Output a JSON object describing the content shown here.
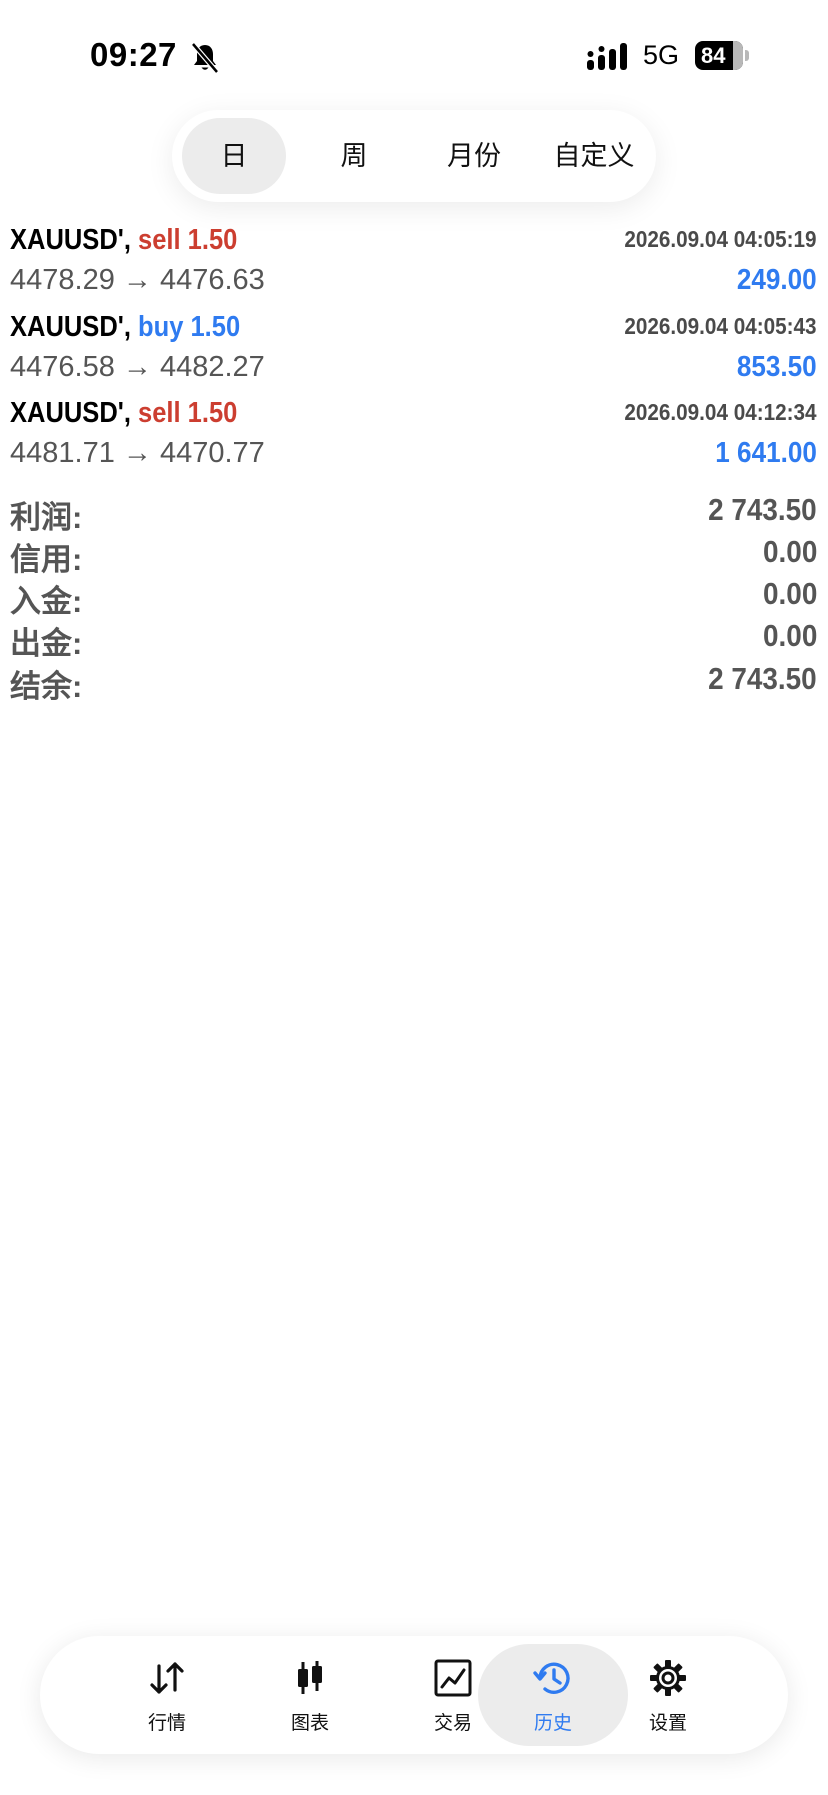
{
  "status_bar": {
    "time": "09:27",
    "network": "5G",
    "battery": "84",
    "icons": [
      "bell-slash-icon",
      "signal-bars-icon",
      "battery-icon"
    ]
  },
  "period_tabs": [
    {
      "label": "日",
      "selected": true
    },
    {
      "label": "周",
      "selected": false
    },
    {
      "label": "月份",
      "selected": false
    },
    {
      "label": "自定义",
      "selected": false
    }
  ],
  "trades": [
    {
      "symbol": "XAUUSD',",
      "side": "sell 1.50",
      "side_type": "sell",
      "time": "2026.09.04 04:05:19",
      "prices": "4478.29 → 4476.63",
      "profit": "249.00"
    },
    {
      "symbol": "XAUUSD',",
      "side": "buy 1.50",
      "side_type": "buy",
      "time": "2026.09.04 04:05:43",
      "prices": "4476.58 → 4482.27",
      "profit": "853.50"
    },
    {
      "symbol": "XAUUSD',",
      "side": "sell 1.50",
      "side_type": "sell",
      "time": "2026.09.04 04:12:34",
      "prices": "4481.71 → 4470.77",
      "profit": "1 641.00"
    }
  ],
  "summary": [
    {
      "label": "利润:",
      "value": "2 743.50"
    },
    {
      "label": "信用:",
      "value": "0.00"
    },
    {
      "label": "入金:",
      "value": "0.00"
    },
    {
      "label": "出金:",
      "value": "0.00"
    },
    {
      "label": "结余:",
      "value": "2 743.50"
    }
  ],
  "bottom_nav": [
    {
      "label": "行情",
      "icon": "quotes-arrows-icon",
      "active": false
    },
    {
      "label": "图表",
      "icon": "candlestick-chart-icon",
      "active": false
    },
    {
      "label": "交易",
      "icon": "trade-chart-icon",
      "active": false
    },
    {
      "label": "历史",
      "icon": "history-clock-icon",
      "active": true
    },
    {
      "label": "设置",
      "icon": "gear-icon",
      "active": false
    }
  ],
  "colors": {
    "sell": "#cc3e30",
    "buy": "#2f7bf0",
    "profit": "#2f7bf0",
    "active_tab_bg": "#ececec",
    "active_nav_label": "#2f7bf0"
  }
}
